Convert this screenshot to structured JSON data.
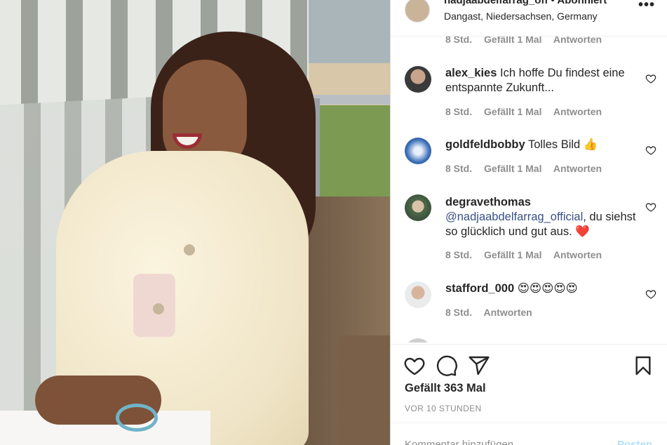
{
  "header": {
    "username": "nadjaabdelfarrag_off",
    "follow_status": "• Abonniert",
    "location": "Dangast, Niedersachsen, Germany",
    "more_icon": "more-horizontal-icon"
  },
  "comments": [
    {
      "partial": true,
      "time": "8 Std.",
      "likes": "Gefällt 1 Mal",
      "reply": "Antworten"
    },
    {
      "username": "alex_kies",
      "text": "Ich hoffe Du findest eine entspannte Zukunft...",
      "time": "8 Std.",
      "likes": "Gefällt 1 Mal",
      "reply": "Antworten"
    },
    {
      "username": "goldfeldbobby",
      "text": "Tolles Bild 👍",
      "time": "8 Std.",
      "likes": "Gefällt 1 Mal",
      "reply": "Antworten"
    },
    {
      "username": "degravethomas",
      "mention": "@nadjaabdelfarrag_official",
      "text": ", du siehst so glücklich und gut aus. ❤️",
      "time": "8 Std.",
      "likes": "Gefällt 1 Mal",
      "reply": "Antworten"
    },
    {
      "username": "stafford_000",
      "text": "😍😍😍😍😍",
      "time": "8 Std.",
      "reply": "Antworten"
    }
  ],
  "actions": {
    "like_icon": "heart-icon",
    "comment_icon": "comment-icon",
    "share_icon": "send-icon",
    "save_icon": "bookmark-icon",
    "likes_count": "Gefällt 363 Mal",
    "timestamp": "VOR 10 STUNDEN"
  },
  "add_comment": {
    "placeholder": "Kommentar hinzufügen ...",
    "post_label": "Posten"
  },
  "colors": {
    "text": "#262626",
    "secondary": "#8e8e8e",
    "link": "#385185",
    "post_disabled": "#b2dffc"
  }
}
